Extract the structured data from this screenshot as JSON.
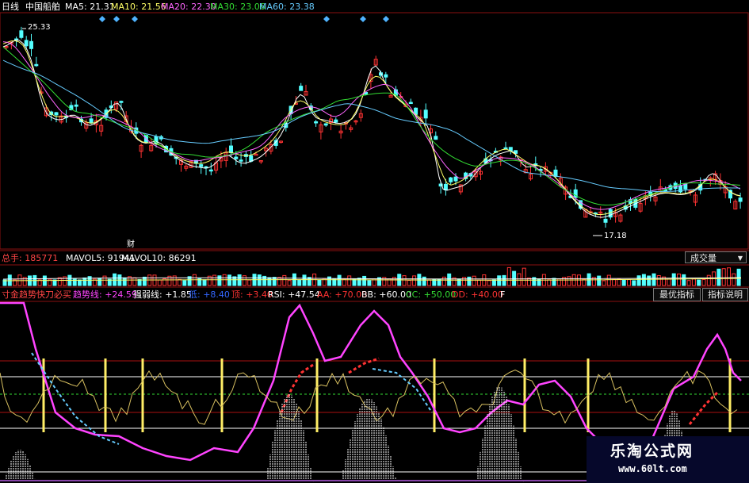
{
  "price_panel": {
    "period_label": "日线",
    "stock_name": "中国船舶",
    "ma": [
      {
        "label": "MA5: 21.31",
        "color": "#ffffff"
      },
      {
        "label": "MA10: 21.56",
        "color": "#ffff66"
      },
      {
        "label": "MA20: 22.30",
        "color": "#ff66ff"
      },
      {
        "label": "MA30: 23.06",
        "color": "#33dd33"
      },
      {
        "label": "MA60: 23.38",
        "color": "#66ccff"
      }
    ],
    "high_label": "25.33",
    "low_label": "17.18",
    "event_marker": "财"
  },
  "volume_panel": {
    "total_label": "总手: 185771",
    "mavol5": "MAVOL5: 91941",
    "mavol10": "MAVOL10: 86291",
    "selector": "成交量",
    "dropdown_icon": "triangle-down"
  },
  "indicator_panel": {
    "name": "寸金趋势快刀必买",
    "terms": [
      {
        "label": "趋势线: +24.59",
        "color": "#ff44ff"
      },
      {
        "label": "强弱线: +1.85",
        "color": "#ffffff"
      },
      {
        "label": "低: +8.40",
        "color": "#3366ff"
      },
      {
        "label": "顶: +3.40",
        "color": "#ff3333"
      },
      {
        "label": "RSI: +47.54",
        "color": "#ffffff"
      },
      {
        "label": "AA: +70.00",
        "color": "#ff3333"
      },
      {
        "label": "BB: +60.00",
        "color": "#ffffff"
      },
      {
        "label": "CC: +50.00",
        "color": "#33dd33"
      },
      {
        "label": "DD: +40.00",
        "color": "#ff3333"
      },
      {
        "label": "F",
        "color": "#ffffff"
      }
    ],
    "btn_optimal": "最优指标",
    "btn_help": "指标说明"
  },
  "watermark": {
    "title": "乐淘公式网",
    "url": "www.60lt.com"
  },
  "colors": {
    "up": "#ff3333",
    "down": "#54ffff",
    "grid_red": "#aa1111",
    "signal_yellow": "#ffee66"
  }
}
